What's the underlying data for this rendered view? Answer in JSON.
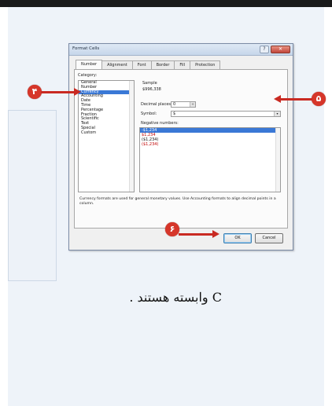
{
  "dialog": {
    "title": "Format Cells",
    "help_glyph": "?",
    "close_glyph": "✕",
    "tabs": [
      {
        "label": "Number"
      },
      {
        "label": "Alignment"
      },
      {
        "label": "Font"
      },
      {
        "label": "Border"
      },
      {
        "label": "Fill"
      },
      {
        "label": "Protection"
      }
    ],
    "category_label": "Category:",
    "categories": [
      {
        "label": "General"
      },
      {
        "label": "Number"
      },
      {
        "label": "Currency"
      },
      {
        "label": "Accounting"
      },
      {
        "label": "Date"
      },
      {
        "label": "Time"
      },
      {
        "label": "Percentage"
      },
      {
        "label": "Fraction"
      },
      {
        "label": "Scientific"
      },
      {
        "label": "Text"
      },
      {
        "label": "Special"
      },
      {
        "label": "Custom"
      }
    ],
    "selected_category": "Currency",
    "sample_label": "Sample",
    "sample_value": "$996,338",
    "decimal_places_label": "Decimal places:",
    "decimal_places_value": "0",
    "symbol_label": "Symbol:",
    "symbol_value": "$",
    "negative_numbers_label": "Negative numbers:",
    "negative_numbers": [
      {
        "label": "-$1,234",
        "color": "black"
      },
      {
        "label": "$1,234",
        "color": "red"
      },
      {
        "label": "($1,234)",
        "color": "black"
      },
      {
        "label": "($1,234)",
        "color": "red"
      }
    ],
    "description": "Currency formats are used for general monetary values. Use Accounting formats to align decimal points in a column.",
    "ok_label": "OK",
    "cancel_label": "Cancel",
    "spin_glyph": "÷",
    "dropdown_glyph": "▾"
  },
  "callouts": [
    {
      "number": "۴"
    },
    {
      "number": "۵"
    },
    {
      "number": "۶"
    }
  ],
  "body_text": {
    "latin": "C",
    "persian": "وابسته هستند ."
  },
  "colors": {
    "callout": "#d6362a",
    "selection": "#3a78d6",
    "negative_red": "#c00000"
  }
}
